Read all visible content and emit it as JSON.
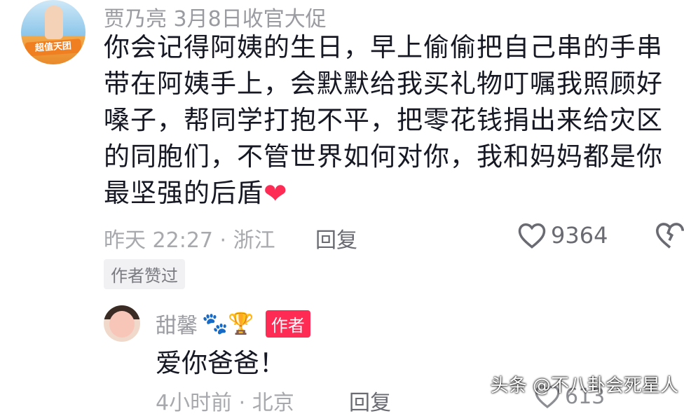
{
  "comment": {
    "author": "贾乃亮 3月8日收官大促",
    "avatar_text": "超值天团",
    "body": "你会记得阿姨的生日，早上偷偷把自己串的手串带在阿姨手上，会默默给我买礼物叮嘱我照顾好嗓子，帮同学打抱不平，把零花钱捐出来给灾区的同胞们，不管世界如何对你，我和妈妈都是你最坚强的后盾",
    "time_location": "昨天 22:27 · 浙江",
    "reply_label": "回复",
    "like_count": "9364",
    "liked_tag": "作者赞过"
  },
  "reply": {
    "author": "甜馨",
    "author_emojis": "🐾🏆",
    "author_badge": "作者",
    "body": "爱你爸爸！",
    "time_location": "4小时前 · 北京",
    "reply_label": "回复",
    "like_count": "613"
  },
  "watermark": "头条 @不八卦会死星人",
  "colors": {
    "accent": "#fe2c55",
    "muted_text": "#9a9ba1",
    "body_text": "#161823"
  }
}
